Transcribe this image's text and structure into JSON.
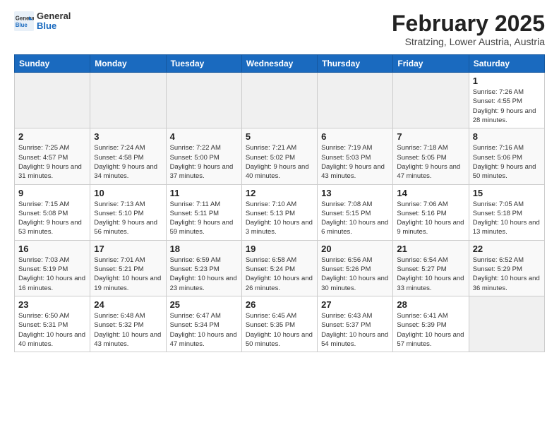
{
  "header": {
    "logo_general": "General",
    "logo_blue": "Blue",
    "month": "February 2025",
    "location": "Stratzing, Lower Austria, Austria"
  },
  "days_of_week": [
    "Sunday",
    "Monday",
    "Tuesday",
    "Wednesday",
    "Thursday",
    "Friday",
    "Saturday"
  ],
  "weeks": [
    {
      "days": [
        {
          "num": "",
          "info": ""
        },
        {
          "num": "",
          "info": ""
        },
        {
          "num": "",
          "info": ""
        },
        {
          "num": "",
          "info": ""
        },
        {
          "num": "",
          "info": ""
        },
        {
          "num": "",
          "info": ""
        },
        {
          "num": "1",
          "info": "Sunrise: 7:26 AM\nSunset: 4:55 PM\nDaylight: 9 hours and 28 minutes."
        }
      ]
    },
    {
      "days": [
        {
          "num": "2",
          "info": "Sunrise: 7:25 AM\nSunset: 4:57 PM\nDaylight: 9 hours and 31 minutes."
        },
        {
          "num": "3",
          "info": "Sunrise: 7:24 AM\nSunset: 4:58 PM\nDaylight: 9 hours and 34 minutes."
        },
        {
          "num": "4",
          "info": "Sunrise: 7:22 AM\nSunset: 5:00 PM\nDaylight: 9 hours and 37 minutes."
        },
        {
          "num": "5",
          "info": "Sunrise: 7:21 AM\nSunset: 5:02 PM\nDaylight: 9 hours and 40 minutes."
        },
        {
          "num": "6",
          "info": "Sunrise: 7:19 AM\nSunset: 5:03 PM\nDaylight: 9 hours and 43 minutes."
        },
        {
          "num": "7",
          "info": "Sunrise: 7:18 AM\nSunset: 5:05 PM\nDaylight: 9 hours and 47 minutes."
        },
        {
          "num": "8",
          "info": "Sunrise: 7:16 AM\nSunset: 5:06 PM\nDaylight: 9 hours and 50 minutes."
        }
      ]
    },
    {
      "days": [
        {
          "num": "9",
          "info": "Sunrise: 7:15 AM\nSunset: 5:08 PM\nDaylight: 9 hours and 53 minutes."
        },
        {
          "num": "10",
          "info": "Sunrise: 7:13 AM\nSunset: 5:10 PM\nDaylight: 9 hours and 56 minutes."
        },
        {
          "num": "11",
          "info": "Sunrise: 7:11 AM\nSunset: 5:11 PM\nDaylight: 9 hours and 59 minutes."
        },
        {
          "num": "12",
          "info": "Sunrise: 7:10 AM\nSunset: 5:13 PM\nDaylight: 10 hours and 3 minutes."
        },
        {
          "num": "13",
          "info": "Sunrise: 7:08 AM\nSunset: 5:15 PM\nDaylight: 10 hours and 6 minutes."
        },
        {
          "num": "14",
          "info": "Sunrise: 7:06 AM\nSunset: 5:16 PM\nDaylight: 10 hours and 9 minutes."
        },
        {
          "num": "15",
          "info": "Sunrise: 7:05 AM\nSunset: 5:18 PM\nDaylight: 10 hours and 13 minutes."
        }
      ]
    },
    {
      "days": [
        {
          "num": "16",
          "info": "Sunrise: 7:03 AM\nSunset: 5:19 PM\nDaylight: 10 hours and 16 minutes."
        },
        {
          "num": "17",
          "info": "Sunrise: 7:01 AM\nSunset: 5:21 PM\nDaylight: 10 hours and 19 minutes."
        },
        {
          "num": "18",
          "info": "Sunrise: 6:59 AM\nSunset: 5:23 PM\nDaylight: 10 hours and 23 minutes."
        },
        {
          "num": "19",
          "info": "Sunrise: 6:58 AM\nSunset: 5:24 PM\nDaylight: 10 hours and 26 minutes."
        },
        {
          "num": "20",
          "info": "Sunrise: 6:56 AM\nSunset: 5:26 PM\nDaylight: 10 hours and 30 minutes."
        },
        {
          "num": "21",
          "info": "Sunrise: 6:54 AM\nSunset: 5:27 PM\nDaylight: 10 hours and 33 minutes."
        },
        {
          "num": "22",
          "info": "Sunrise: 6:52 AM\nSunset: 5:29 PM\nDaylight: 10 hours and 36 minutes."
        }
      ]
    },
    {
      "days": [
        {
          "num": "23",
          "info": "Sunrise: 6:50 AM\nSunset: 5:31 PM\nDaylight: 10 hours and 40 minutes."
        },
        {
          "num": "24",
          "info": "Sunrise: 6:48 AM\nSunset: 5:32 PM\nDaylight: 10 hours and 43 minutes."
        },
        {
          "num": "25",
          "info": "Sunrise: 6:47 AM\nSunset: 5:34 PM\nDaylight: 10 hours and 47 minutes."
        },
        {
          "num": "26",
          "info": "Sunrise: 6:45 AM\nSunset: 5:35 PM\nDaylight: 10 hours and 50 minutes."
        },
        {
          "num": "27",
          "info": "Sunrise: 6:43 AM\nSunset: 5:37 PM\nDaylight: 10 hours and 54 minutes."
        },
        {
          "num": "28",
          "info": "Sunrise: 6:41 AM\nSunset: 5:39 PM\nDaylight: 10 hours and 57 minutes."
        },
        {
          "num": "",
          "info": ""
        }
      ]
    }
  ]
}
